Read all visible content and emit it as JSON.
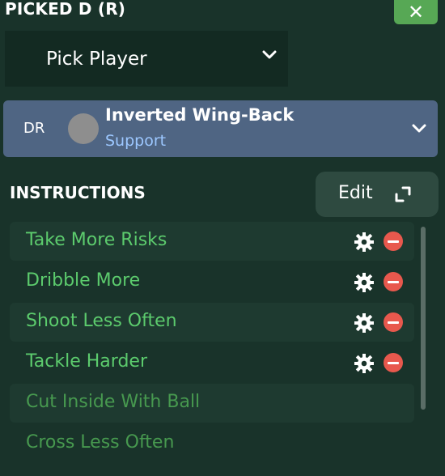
{
  "panel": {
    "title": "PICKED D (R)",
    "close_label": "✕"
  },
  "pick": {
    "label": "Pick Player"
  },
  "role": {
    "position": "DR",
    "name": "Inverted Wing-Back",
    "duty": "Support"
  },
  "instructions": {
    "heading": "INSTRUCTIONS",
    "edit_label": "Edit",
    "items": [
      {
        "label": "Take More Risks",
        "active": true
      },
      {
        "label": "Dribble More",
        "active": true
      },
      {
        "label": "Shoot Less Often",
        "active": true
      },
      {
        "label": "Tackle Harder",
        "active": true
      },
      {
        "label": "Cut Inside With Ball",
        "active": false
      },
      {
        "label": "Cross Less Often",
        "active": false
      }
    ]
  },
  "colors": {
    "background": "#19332a",
    "accent_green": "#57a855",
    "role_card": "#4f6583",
    "instruction_text": "#5ccb6d",
    "remove_red": "#e8584d"
  }
}
